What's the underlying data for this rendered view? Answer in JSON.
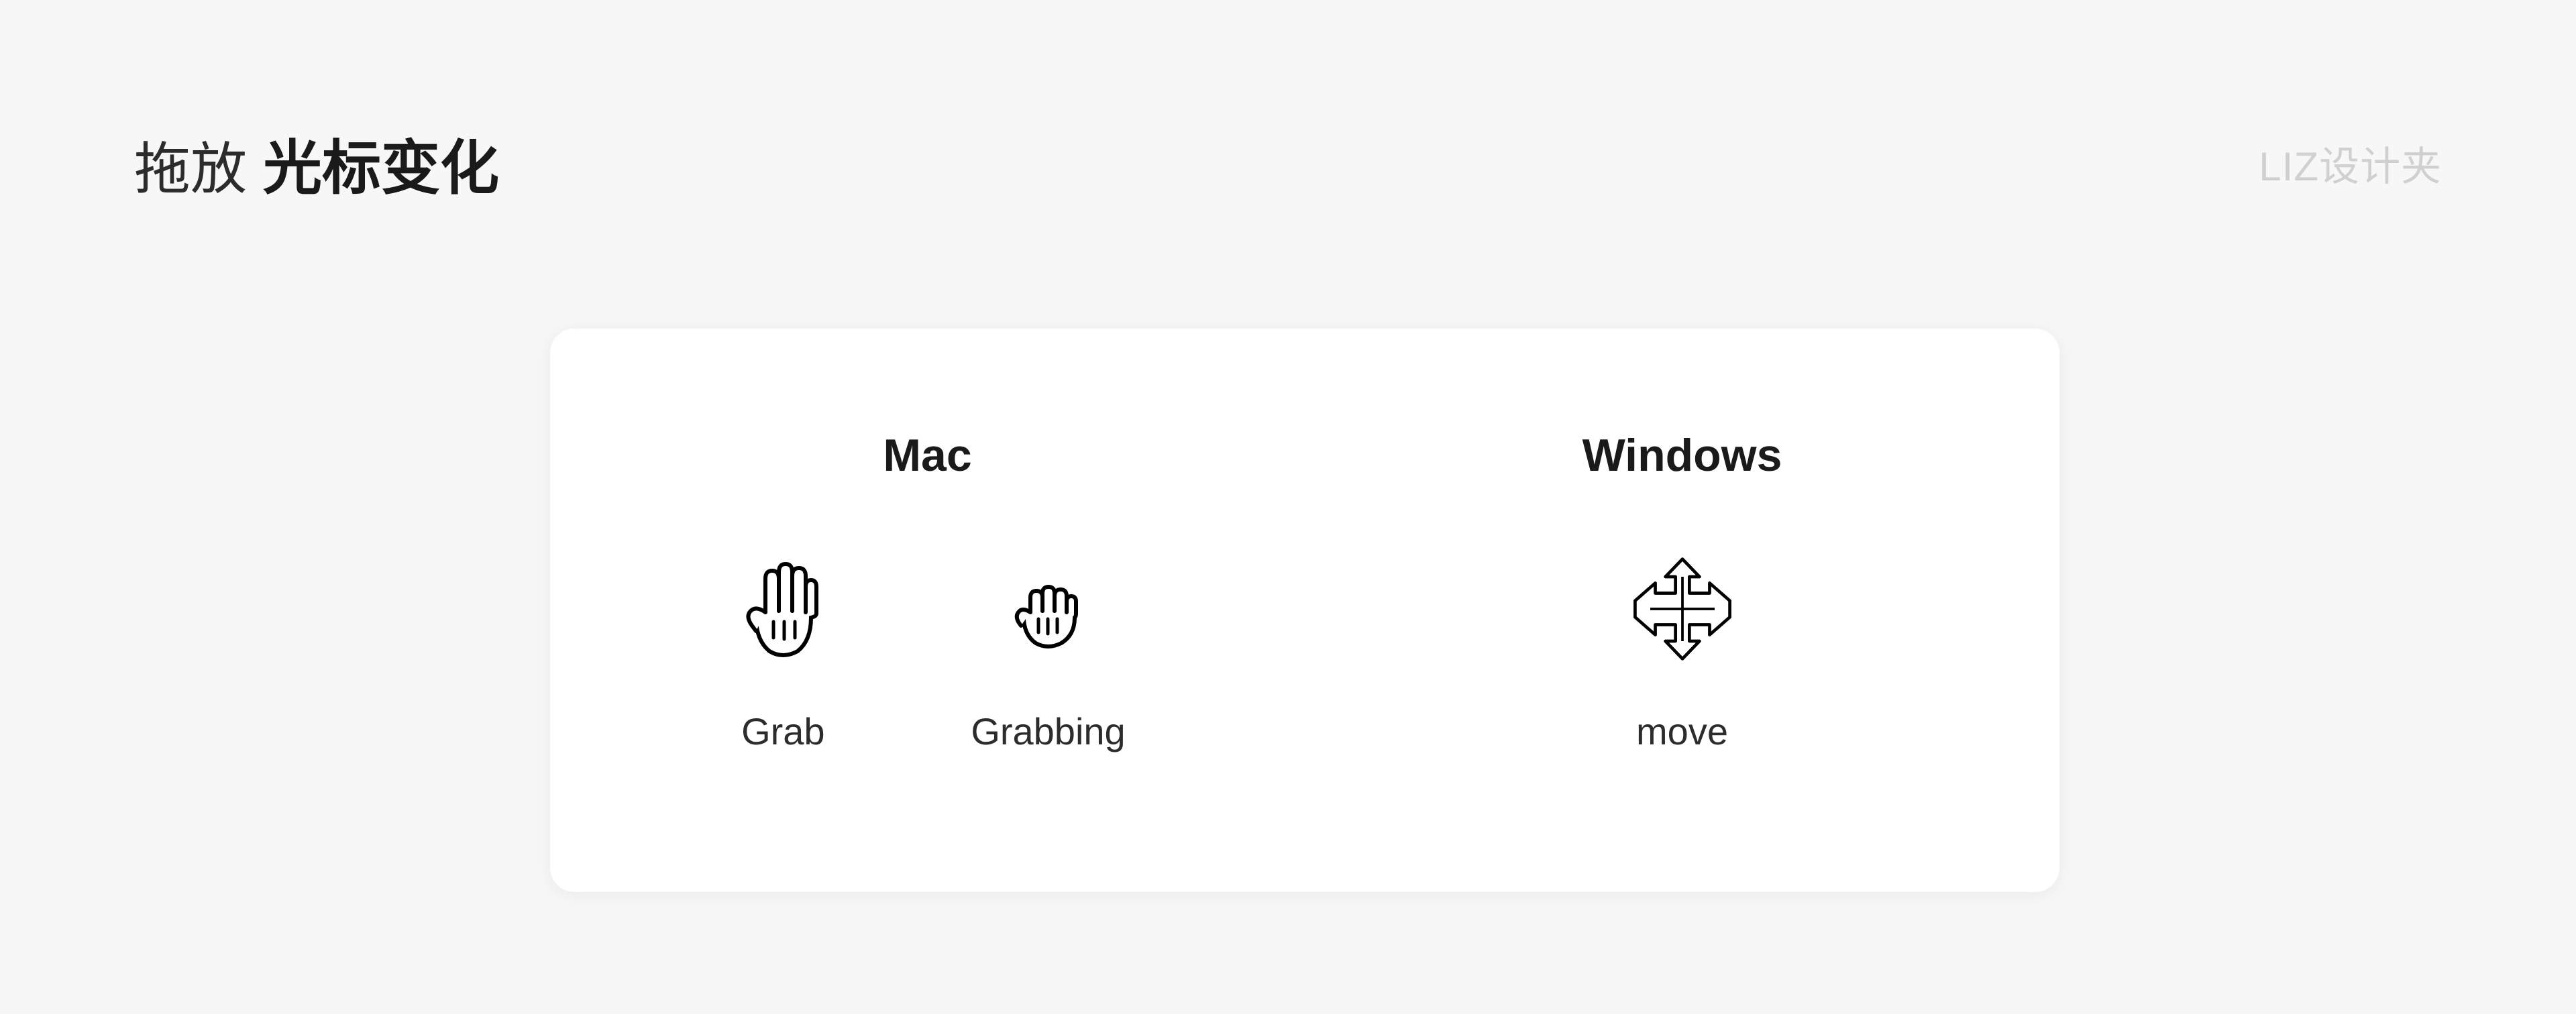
{
  "header": {
    "title_light": "拖放",
    "title_bold": "光标变化",
    "watermark": "LIZ设计夹"
  },
  "card": {
    "columns": [
      {
        "heading": "Mac",
        "cursors": [
          {
            "label": "Grab",
            "icon": "grab-hand-icon"
          },
          {
            "label": "Grabbing",
            "icon": "grabbing-hand-icon"
          }
        ]
      },
      {
        "heading": "Windows",
        "cursors": [
          {
            "label": "move",
            "icon": "move-cursor-icon"
          }
        ]
      }
    ]
  }
}
